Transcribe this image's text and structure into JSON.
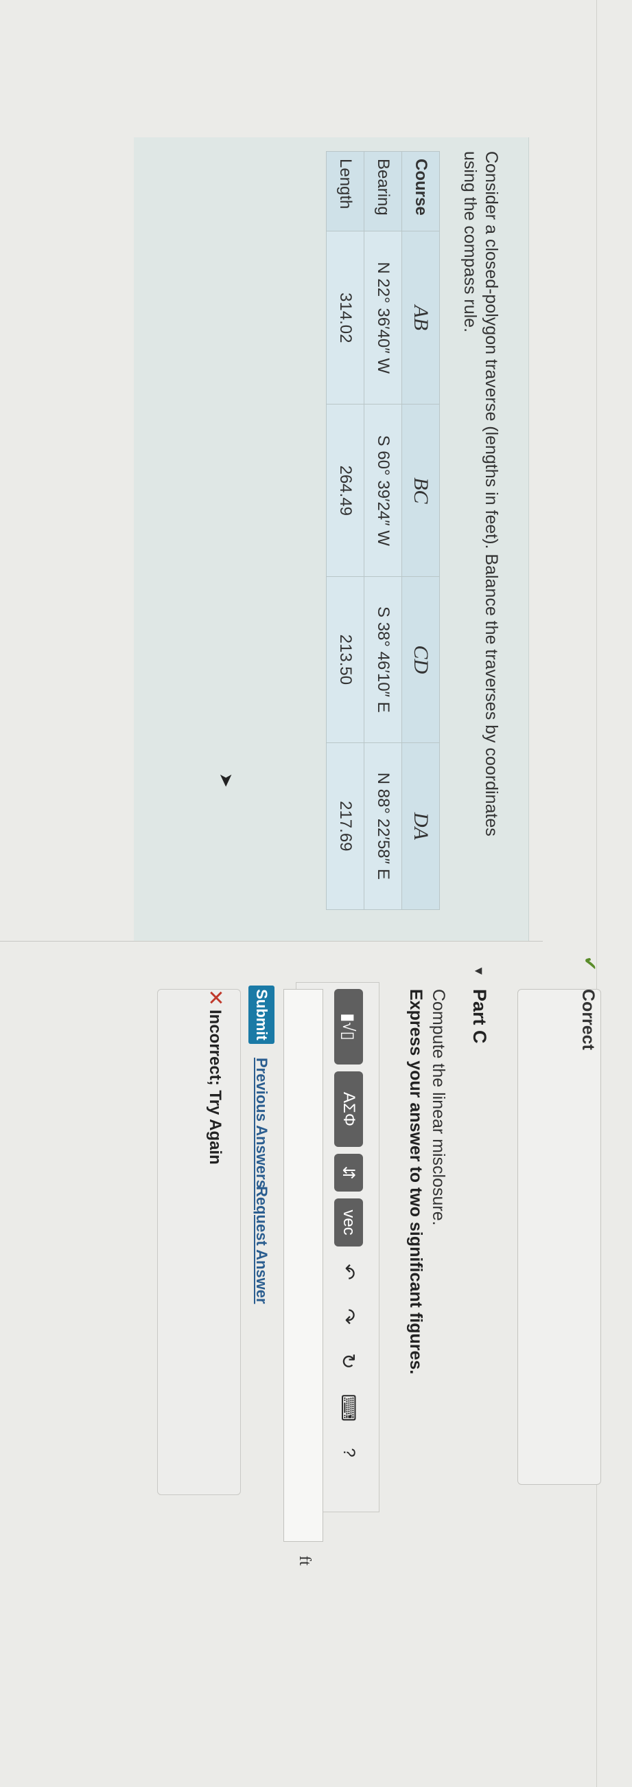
{
  "problem": {
    "intro": "Consider a closed-polygon traverse (lengths in feet). Balance the traverses by coordinates using the compass rule.",
    "table": {
      "header_label": "Course",
      "courses": [
        "AB",
        "BC",
        "CD",
        "DA"
      ],
      "rows": [
        {
          "label": "Bearing",
          "values": [
            "N 22° 36′40″ W",
            "S 60° 39′24″ W",
            "S 38° 46′10″ E",
            "N 88° 22′58″ E"
          ]
        },
        {
          "label": "Length",
          "values": [
            "314.02",
            "264.49",
            "213.50",
            "217.69"
          ]
        }
      ]
    }
  },
  "previous_part": {
    "status": "Correct",
    "check_icon": "✔"
  },
  "part_c": {
    "title": "Part C",
    "prompt": "Compute the linear misclosure.",
    "instruction": "Express your answer to two significant figures.",
    "toolbar": {
      "templates_icon": "▮√▯",
      "greek_label": "ΑΣΦ",
      "swap_icon": "⇵",
      "vec_label": "vec",
      "undo_icon": "↶",
      "redo_icon": "↷",
      "reset_icon": "↻",
      "keyboard_icon": "⌨",
      "help_icon": "?"
    },
    "answer_value": "",
    "unit": "ft",
    "submit_label": "Submit",
    "previous_answers_label": "Previous Answers",
    "request_answer_label": "Request Answer",
    "feedback": {
      "icon": "✕",
      "text": "Incorrect; Try Again"
    }
  },
  "colors": {
    "submit": "#1a7aa6",
    "incorrect": "#c0392b",
    "correct": "#5a8c2a",
    "table_header": "#cfe1e8",
    "panel": "#dfe7e5"
  }
}
